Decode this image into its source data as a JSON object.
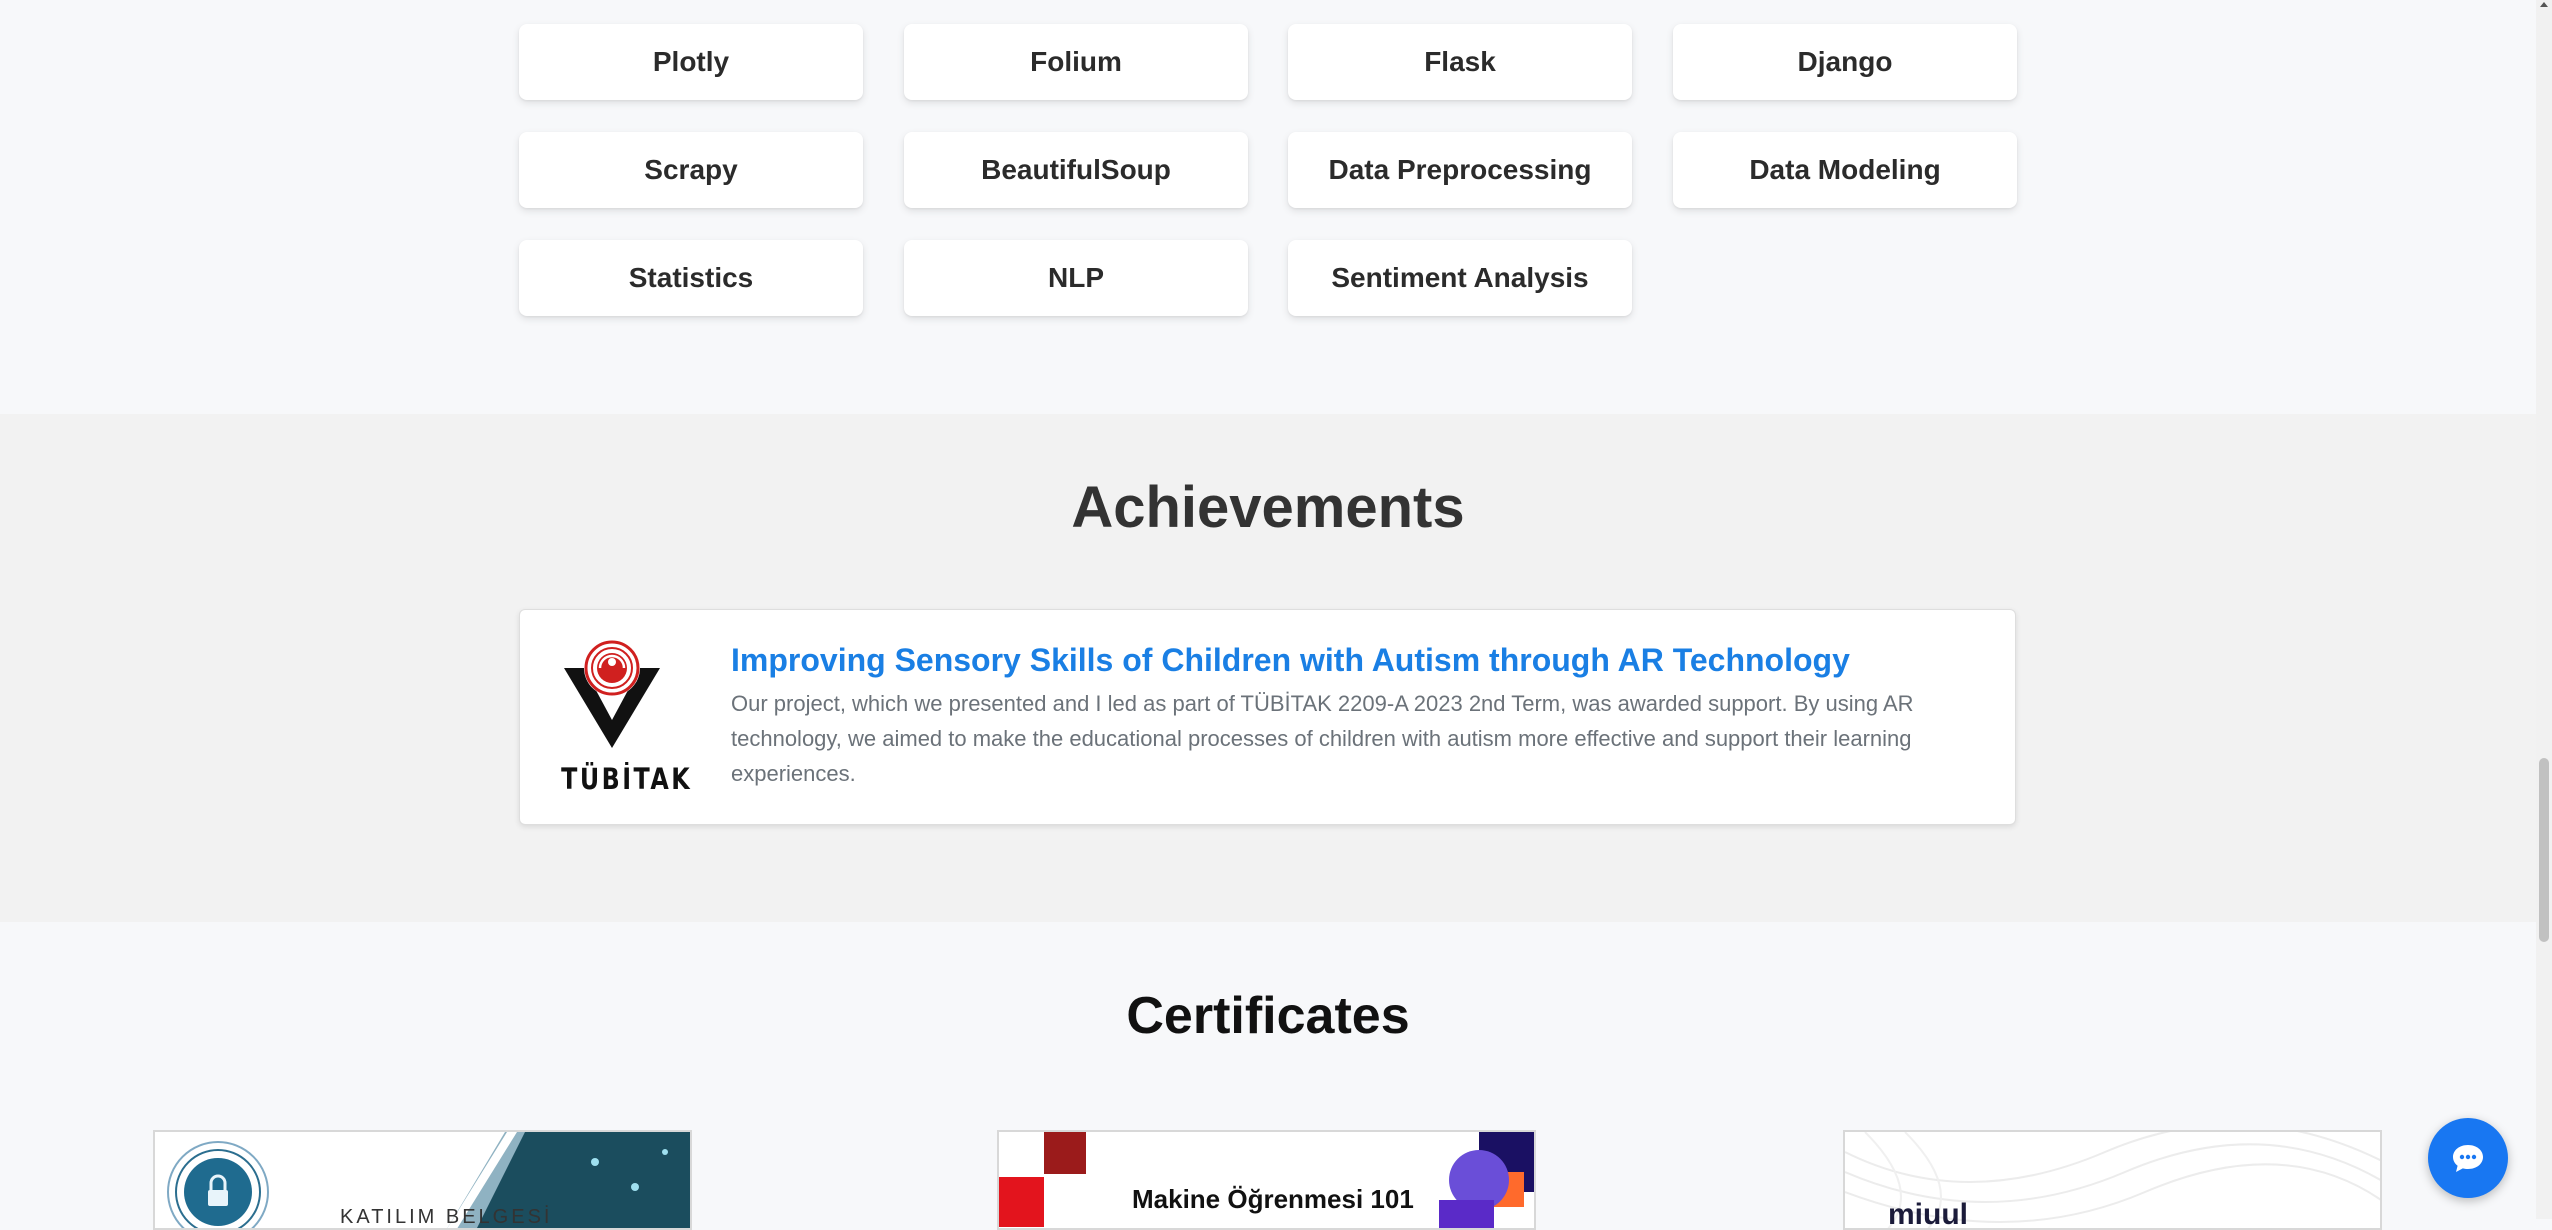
{
  "skills": [
    {
      "label": "Plotly"
    },
    {
      "label": "Folium"
    },
    {
      "label": "Flask"
    },
    {
      "label": "Django"
    },
    {
      "label": "Scrapy"
    },
    {
      "label": "BeautifulSoup"
    },
    {
      "label": "Data Preprocessing"
    },
    {
      "label": "Data Modeling"
    },
    {
      "label": "Statistics"
    },
    {
      "label": "NLP"
    },
    {
      "label": "Sentiment Analysis"
    }
  ],
  "achievements": {
    "title": "Achievements",
    "items": [
      {
        "logo_text": "TÜBİTAK",
        "heading": "Improving Sensory Skills of Children with Autism through AR Technology",
        "description": "Our project, which we presented and I led as part of TÜBİTAK 2209-A 2023 2nd Term, was awarded support. By using AR technology, we aimed to make the educational processes of children with autism more effective and support their learning experiences."
      }
    ]
  },
  "certificates": {
    "title": "Certificates",
    "items": [
      {
        "text": "KATILIM BELGESİ"
      },
      {
        "text": "Makine Öğrenmesi 101"
      },
      {
        "text": "miuul"
      }
    ]
  },
  "colors": {
    "accent": "#1a7fe4",
    "chat_button": "#1877f2",
    "achievements_bg": "#f2f2f2",
    "page_bg": "#f7f8fa"
  },
  "icons": {
    "chat": "chat-bubble-icon",
    "tubitak": "tubitak-logo"
  }
}
